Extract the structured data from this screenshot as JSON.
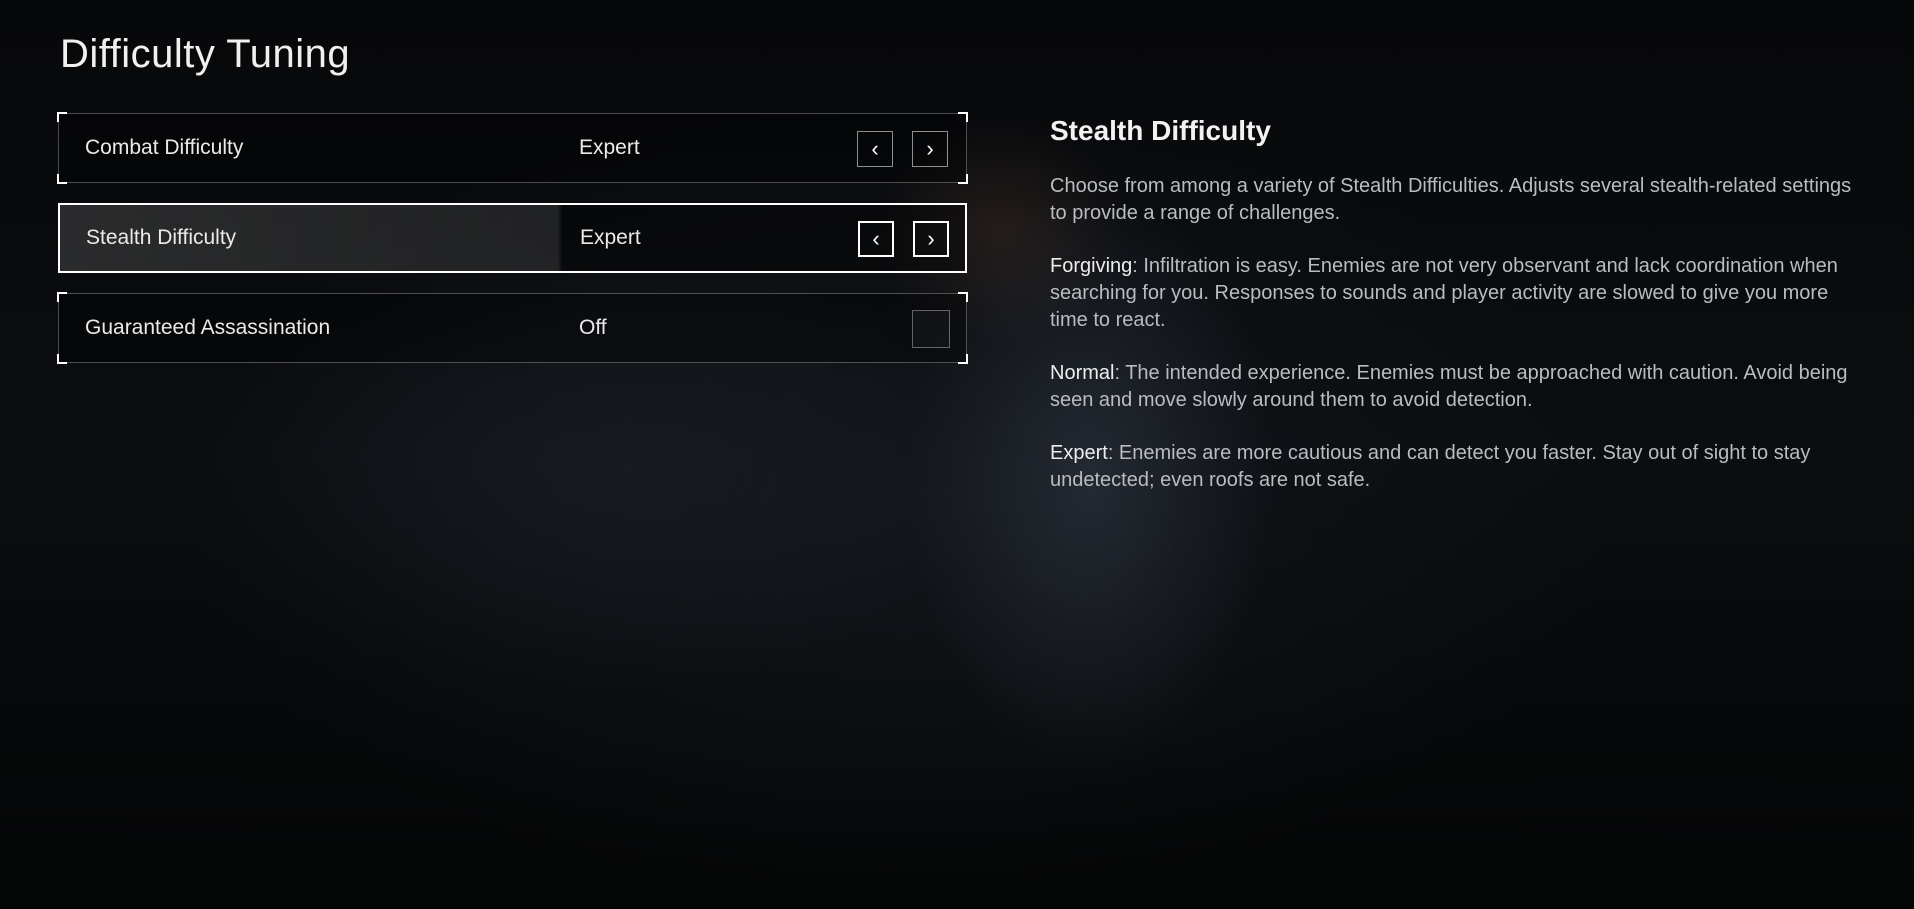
{
  "page": {
    "title": "Difficulty Tuning"
  },
  "settings": [
    {
      "label": "Combat Difficulty",
      "value": "Expert",
      "control": "arrows",
      "selected": false,
      "prev_icon": "chevron-left-icon",
      "next_icon": "chevron-right-icon",
      "prev_glyph": "‹",
      "next_glyph": "›"
    },
    {
      "label": "Stealth Difficulty",
      "value": "Expert",
      "control": "arrows",
      "selected": true,
      "prev_icon": "chevron-left-icon",
      "next_icon": "chevron-right-icon",
      "prev_glyph": "‹",
      "next_glyph": "›"
    },
    {
      "label": "Guaranteed Assassination",
      "value": "Off",
      "control": "checkbox",
      "checked": false
    }
  ],
  "info": {
    "heading": "Stealth Difficulty",
    "intro": "Choose from among a variety of Stealth Difficulties. Adjusts several stealth-related settings to provide a range of challenges.",
    "levels": [
      {
        "name": "Forgiving",
        "text": ": Infiltration is easy. Enemies are not very observant and lack coordination when searching for you. Responses to sounds and player activity are slowed to give you more time to react."
      },
      {
        "name": "Normal",
        "text": ": The intended experience. Enemies must be approached with caution. Avoid being seen and move slowly around them to avoid detection."
      },
      {
        "name": "Expert",
        "text": ": Enemies are more cautious and can detect you faster. Stay out of sight to stay undetected; even roofs are not safe."
      }
    ]
  },
  "colors": {
    "background": "#050607",
    "text": "#e6e6e6",
    "muted_text": "#b9bcc0",
    "selection_border": "#ffffff"
  }
}
